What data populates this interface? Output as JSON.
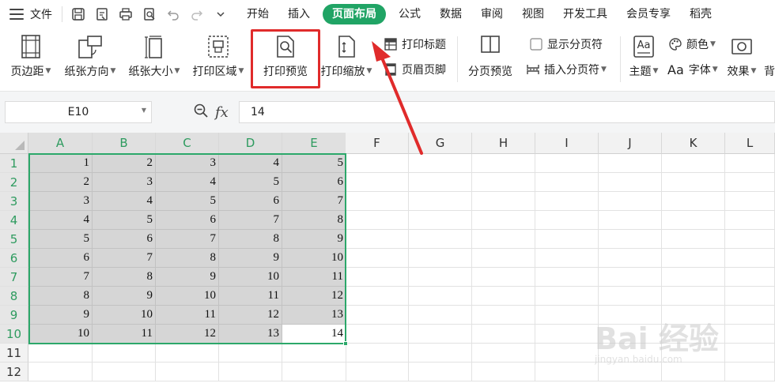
{
  "menubar": {
    "file_label": "文件",
    "tabs": [
      "开始",
      "插入",
      "页面布局",
      "公式",
      "数据",
      "审阅",
      "视图",
      "开发工具",
      "会员专享",
      "稻壳"
    ],
    "active_tab": "页面布局"
  },
  "ribbon": {
    "margins": "页边距",
    "orientation": "纸张方向",
    "size": "纸张大小",
    "print_area": "打印区域",
    "print_preview": "打印预览",
    "print_scale": "打印缩放",
    "print_titles": "打印标题",
    "header_footer": "页眉页脚",
    "page_break_preview": "分页预览",
    "show_page_breaks": "显示分页符",
    "insert_page_break": "插入分页符",
    "theme": "主题",
    "theme_icon_text": "Aa",
    "colors": "颜色",
    "fonts": "字体",
    "fonts_prefix": "Aa",
    "effects": "效果",
    "background": "背"
  },
  "formula_bar": {
    "name_box": "E10",
    "fx": "fx",
    "value": "14"
  },
  "grid": {
    "columns": [
      "A",
      "B",
      "C",
      "D",
      "E",
      "F",
      "G",
      "H",
      "I",
      "J",
      "K",
      "L"
    ],
    "rows": [
      "1",
      "2",
      "3",
      "4",
      "5",
      "6",
      "7",
      "8",
      "9",
      "10",
      "11",
      "12"
    ],
    "data": [
      [
        "1",
        "2",
        "3",
        "4",
        "5"
      ],
      [
        "2",
        "3",
        "4",
        "5",
        "6"
      ],
      [
        "3",
        "4",
        "5",
        "6",
        "7"
      ],
      [
        "4",
        "5",
        "6",
        "7",
        "8"
      ],
      [
        "5",
        "6",
        "7",
        "8",
        "9"
      ],
      [
        "6",
        "7",
        "8",
        "9",
        "10"
      ],
      [
        "7",
        "8",
        "9",
        "10",
        "11"
      ],
      [
        "8",
        "9",
        "10",
        "11",
        "12"
      ],
      [
        "9",
        "10",
        "11",
        "12",
        "13"
      ],
      [
        "10",
        "11",
        "12",
        "13",
        "14"
      ]
    ],
    "selected_range": "A1:E10",
    "active_cell": "E10"
  },
  "colors": {
    "accent": "#20a465",
    "highlight": "#e02b2b",
    "selection": "#2ca86a"
  },
  "watermark": {
    "main": "Bai 经验",
    "sub": "jingyan.baidu.com"
  }
}
